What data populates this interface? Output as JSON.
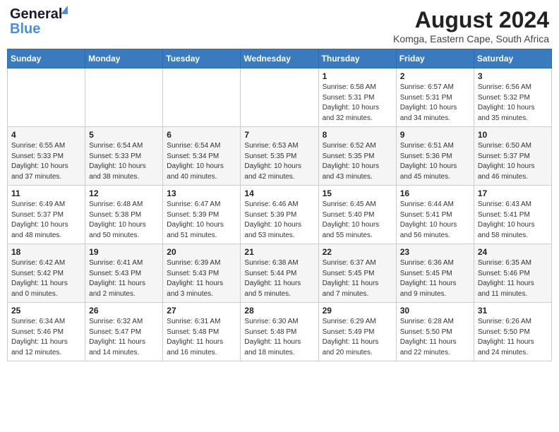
{
  "header": {
    "logo_line1": "General",
    "logo_line2": "Blue",
    "month_year": "August 2024",
    "location": "Komga, Eastern Cape, South Africa"
  },
  "days_of_week": [
    "Sunday",
    "Monday",
    "Tuesday",
    "Wednesday",
    "Thursday",
    "Friday",
    "Saturday"
  ],
  "weeks": [
    [
      {
        "day": "",
        "content": ""
      },
      {
        "day": "",
        "content": ""
      },
      {
        "day": "",
        "content": ""
      },
      {
        "day": "",
        "content": ""
      },
      {
        "day": "1",
        "content": "Sunrise: 6:58 AM\nSunset: 5:31 PM\nDaylight: 10 hours\nand 32 minutes."
      },
      {
        "day": "2",
        "content": "Sunrise: 6:57 AM\nSunset: 5:31 PM\nDaylight: 10 hours\nand 34 minutes."
      },
      {
        "day": "3",
        "content": "Sunrise: 6:56 AM\nSunset: 5:32 PM\nDaylight: 10 hours\nand 35 minutes."
      }
    ],
    [
      {
        "day": "4",
        "content": "Sunrise: 6:55 AM\nSunset: 5:33 PM\nDaylight: 10 hours\nand 37 minutes."
      },
      {
        "day": "5",
        "content": "Sunrise: 6:54 AM\nSunset: 5:33 PM\nDaylight: 10 hours\nand 38 minutes."
      },
      {
        "day": "6",
        "content": "Sunrise: 6:54 AM\nSunset: 5:34 PM\nDaylight: 10 hours\nand 40 minutes."
      },
      {
        "day": "7",
        "content": "Sunrise: 6:53 AM\nSunset: 5:35 PM\nDaylight: 10 hours\nand 42 minutes."
      },
      {
        "day": "8",
        "content": "Sunrise: 6:52 AM\nSunset: 5:35 PM\nDaylight: 10 hours\nand 43 minutes."
      },
      {
        "day": "9",
        "content": "Sunrise: 6:51 AM\nSunset: 5:36 PM\nDaylight: 10 hours\nand 45 minutes."
      },
      {
        "day": "10",
        "content": "Sunrise: 6:50 AM\nSunset: 5:37 PM\nDaylight: 10 hours\nand 46 minutes."
      }
    ],
    [
      {
        "day": "11",
        "content": "Sunrise: 6:49 AM\nSunset: 5:37 PM\nDaylight: 10 hours\nand 48 minutes."
      },
      {
        "day": "12",
        "content": "Sunrise: 6:48 AM\nSunset: 5:38 PM\nDaylight: 10 hours\nand 50 minutes."
      },
      {
        "day": "13",
        "content": "Sunrise: 6:47 AM\nSunset: 5:39 PM\nDaylight: 10 hours\nand 51 minutes."
      },
      {
        "day": "14",
        "content": "Sunrise: 6:46 AM\nSunset: 5:39 PM\nDaylight: 10 hours\nand 53 minutes."
      },
      {
        "day": "15",
        "content": "Sunrise: 6:45 AM\nSunset: 5:40 PM\nDaylight: 10 hours\nand 55 minutes."
      },
      {
        "day": "16",
        "content": "Sunrise: 6:44 AM\nSunset: 5:41 PM\nDaylight: 10 hours\nand 56 minutes."
      },
      {
        "day": "17",
        "content": "Sunrise: 6:43 AM\nSunset: 5:41 PM\nDaylight: 10 hours\nand 58 minutes."
      }
    ],
    [
      {
        "day": "18",
        "content": "Sunrise: 6:42 AM\nSunset: 5:42 PM\nDaylight: 11 hours\nand 0 minutes."
      },
      {
        "day": "19",
        "content": "Sunrise: 6:41 AM\nSunset: 5:43 PM\nDaylight: 11 hours\nand 2 minutes."
      },
      {
        "day": "20",
        "content": "Sunrise: 6:39 AM\nSunset: 5:43 PM\nDaylight: 11 hours\nand 3 minutes."
      },
      {
        "day": "21",
        "content": "Sunrise: 6:38 AM\nSunset: 5:44 PM\nDaylight: 11 hours\nand 5 minutes."
      },
      {
        "day": "22",
        "content": "Sunrise: 6:37 AM\nSunset: 5:45 PM\nDaylight: 11 hours\nand 7 minutes."
      },
      {
        "day": "23",
        "content": "Sunrise: 6:36 AM\nSunset: 5:45 PM\nDaylight: 11 hours\nand 9 minutes."
      },
      {
        "day": "24",
        "content": "Sunrise: 6:35 AM\nSunset: 5:46 PM\nDaylight: 11 hours\nand 11 minutes."
      }
    ],
    [
      {
        "day": "25",
        "content": "Sunrise: 6:34 AM\nSunset: 5:46 PM\nDaylight: 11 hours\nand 12 minutes."
      },
      {
        "day": "26",
        "content": "Sunrise: 6:32 AM\nSunset: 5:47 PM\nDaylight: 11 hours\nand 14 minutes."
      },
      {
        "day": "27",
        "content": "Sunrise: 6:31 AM\nSunset: 5:48 PM\nDaylight: 11 hours\nand 16 minutes."
      },
      {
        "day": "28",
        "content": "Sunrise: 6:30 AM\nSunset: 5:48 PM\nDaylight: 11 hours\nand 18 minutes."
      },
      {
        "day": "29",
        "content": "Sunrise: 6:29 AM\nSunset: 5:49 PM\nDaylight: 11 hours\nand 20 minutes."
      },
      {
        "day": "30",
        "content": "Sunrise: 6:28 AM\nSunset: 5:50 PM\nDaylight: 11 hours\nand 22 minutes."
      },
      {
        "day": "31",
        "content": "Sunrise: 6:26 AM\nSunset: 5:50 PM\nDaylight: 11 hours\nand 24 minutes."
      }
    ]
  ]
}
